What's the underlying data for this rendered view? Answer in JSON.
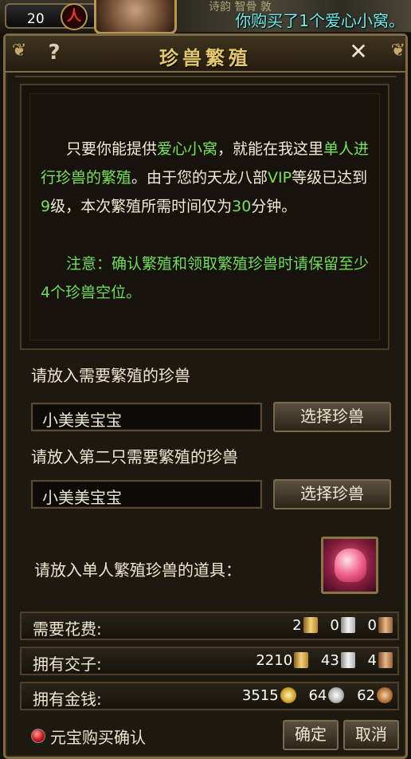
{
  "top": {
    "level": "20",
    "emblem": "人",
    "scene_text": "诗韵 智骨 敦",
    "notice": "你购买了1个爱心小窝。"
  },
  "window": {
    "title": "珍兽繁殖",
    "help_symbol": "?",
    "close_symbol": "✕"
  },
  "description": {
    "p1_a": "只要你能提供",
    "p1_b": "爱心小窝",
    "p1_c": "，就能在我这里",
    "p1_d": "单人进行珍兽的繁殖",
    "p1_e": "。由于您的天龙八部",
    "p1_f": "VIP",
    "p1_g": "等级已达到",
    "p1_h": "9",
    "p1_i": "级，本次繁殖所需时间仅为",
    "p1_j": "30",
    "p1_k": "分钟。",
    "p2": "注意：确认繁殖和领取繁殖珍兽时请保留至少4个珍兽空位。"
  },
  "pet1": {
    "label": "请放入需要繁殖的珍兽",
    "value": "小美美宝宝",
    "button": "选择珍兽"
  },
  "pet2": {
    "label": "请放入第二只需要繁殖的珍兽",
    "value": "小美美宝宝",
    "button": "选择珍兽"
  },
  "item": {
    "label": "请放入单人繁殖珍兽的道具：",
    "icon": "pink-bag-icon"
  },
  "costs": [
    {
      "label": "需要花费:",
      "v1": "2",
      "v2": "0",
      "v3": "0"
    },
    {
      "label": "拥有交子:",
      "v1": "2210",
      "v2": "43",
      "v3": "4"
    },
    {
      "label": "拥有金钱:",
      "v1": "3515",
      "v2": "64",
      "v3": "62"
    }
  ],
  "bottom": {
    "radio_label": "元宝购买确认",
    "ok": "确定",
    "cancel": "取消"
  },
  "colors": {
    "highlight_green": "#78e25a",
    "notice_cyan": "#6ef0f0",
    "title_gold": "#e6c86a",
    "frame": "#7e6a44"
  }
}
